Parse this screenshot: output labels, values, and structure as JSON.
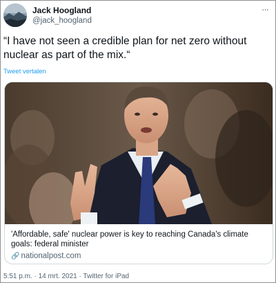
{
  "author": {
    "display_name": "Jack Hoogland",
    "handle": "@jack_hoogland",
    "avatar_icon": "avatar-landscape"
  },
  "more_icon": "more-horizontal-icon",
  "more_glyph": "···",
  "tweet": {
    "text": "“I have not seen a credible plan for net zero without nuclear as part of the mix.“",
    "translate_label": "Tweet vertalen"
  },
  "card": {
    "image_description_icon": "photo-man-speaking-in-parliament",
    "title": "'Affordable, safe' nuclear power is key to reaching Canada's climate goals: federal minister",
    "link_icon": "link-icon",
    "link_glyph": "🔗",
    "domain": "nationalpost.com"
  },
  "footer": {
    "timestamp": "5:51 p.m. · 14 mrt. 2021 · Twitter for iPad"
  },
  "colors": {
    "accent": "#1d9bf0",
    "secondary_text": "#536471",
    "primary_text": "#0f1419",
    "border": "#cfd9de"
  }
}
